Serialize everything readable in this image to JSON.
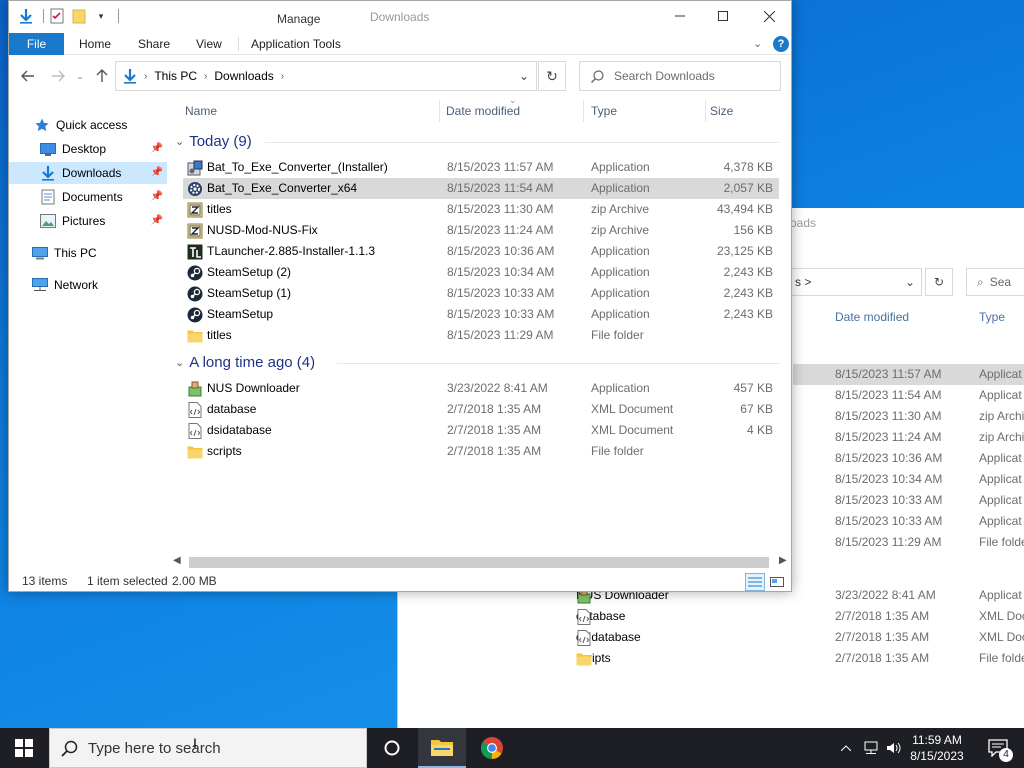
{
  "background_window": {
    "title": "oads",
    "address_crumb": "s",
    "search_text": "Sea",
    "headers": {
      "date": "Date modified",
      "type": "Type"
    },
    "rows": [
      {
        "date": "8/15/2023 11:57 AM",
        "type": "Applicat",
        "selected": true
      },
      {
        "date": "8/15/2023 11:54 AM",
        "type": "Applicat"
      },
      {
        "date": "8/15/2023 11:30 AM",
        "type": "zip Archi"
      },
      {
        "date": "8/15/2023 11:24 AM",
        "type": "zip Archi"
      },
      {
        "date": "8/15/2023 10:36 AM",
        "type": "Applicat"
      },
      {
        "date": "8/15/2023 10:34 AM",
        "type": "Applicat"
      },
      {
        "date": "8/15/2023 10:33 AM",
        "type": "Applicat"
      },
      {
        "date": "8/15/2023 10:33 AM",
        "type": "Applicat"
      },
      {
        "date": "8/15/2023 11:29 AM",
        "type": "File folde"
      }
    ],
    "old_rows": [
      {
        "name": "NUS Downloader",
        "date": "3/23/2022 8:41 AM",
        "type": "Applicat"
      },
      {
        "name": "database",
        "date": "2/7/2018 1:35 AM",
        "type": "XML Doc"
      },
      {
        "name": "dsidatabase",
        "date": "2/7/2018 1:35 AM",
        "type": "XML Doc"
      },
      {
        "name": "scripts",
        "date": "2/7/2018 1:35 AM",
        "type": "File folde"
      }
    ]
  },
  "window": {
    "title": "Downloads",
    "manage_label": "Manage",
    "tabs": {
      "file": "File",
      "home": "Home",
      "share": "Share",
      "view": "View",
      "app_tools": "Application Tools"
    },
    "help": "?",
    "address": {
      "crumb1": "This PC",
      "crumb2": "Downloads"
    },
    "search_placeholder": "Search Downloads",
    "nav": {
      "quick_access": "Quick access",
      "desktop": "Desktop",
      "downloads": "Downloads",
      "documents": "Documents",
      "pictures": "Pictures",
      "this_pc": "This PC",
      "network": "Network"
    },
    "columns": {
      "name": "Name",
      "date": "Date modified",
      "type": "Type",
      "size": "Size"
    },
    "groups": {
      "today": "Today (9)",
      "old": "A long time ago (4)"
    },
    "today_files": [
      {
        "name": "Bat_To_Exe_Converter_(Installer)",
        "date": "8/15/2023 11:57 AM",
        "type": "Application",
        "size": "4,378 KB",
        "icon": "installer-icon"
      },
      {
        "name": "Bat_To_Exe_Converter_x64",
        "date": "8/15/2023 11:54 AM",
        "type": "Application",
        "size": "2,057 KB",
        "icon": "gear-app-icon",
        "selected": true
      },
      {
        "name": "titles",
        "date": "8/15/2023 11:30 AM",
        "type": "zip Archive",
        "size": "43,494 KB",
        "icon": "zip-icon"
      },
      {
        "name": "NUSD-Mod-NUS-Fix",
        "date": "8/15/2023 11:24 AM",
        "type": "zip Archive",
        "size": "156 KB",
        "icon": "zip-icon"
      },
      {
        "name": "TLauncher-2.885-Installer-1.1.3",
        "date": "8/15/2023 10:36 AM",
        "type": "Application",
        "size": "23,125 KB",
        "icon": "tlauncher-icon"
      },
      {
        "name": "SteamSetup (2)",
        "date": "8/15/2023 10:34 AM",
        "type": "Application",
        "size": "2,243 KB",
        "icon": "steam-icon"
      },
      {
        "name": "SteamSetup (1)",
        "date": "8/15/2023 10:33 AM",
        "type": "Application",
        "size": "2,243 KB",
        "icon": "steam-icon"
      },
      {
        "name": "SteamSetup",
        "date": "8/15/2023 10:33 AM",
        "type": "Application",
        "size": "2,243 KB",
        "icon": "steam-icon"
      },
      {
        "name": "titles",
        "date": "8/15/2023 11:29 AM",
        "type": "File folder",
        "size": "",
        "icon": "folder-icon"
      }
    ],
    "old_files": [
      {
        "name": "NUS Downloader",
        "date": "3/23/2022 8:41 AM",
        "type": "Application",
        "size": "457 KB",
        "icon": "nus-app-icon"
      },
      {
        "name": "database",
        "date": "2/7/2018 1:35 AM",
        "type": "XML Document",
        "size": "67 KB",
        "icon": "xml-doc-icon"
      },
      {
        "name": "dsidatabase",
        "date": "2/7/2018 1:35 AM",
        "type": "XML Document",
        "size": "4 KB",
        "icon": "xml-doc-icon"
      },
      {
        "name": "scripts",
        "date": "2/7/2018 1:35 AM",
        "type": "File folder",
        "size": "",
        "icon": "folder-icon"
      }
    ],
    "status": {
      "items": "13 items",
      "selected": "1 item selected",
      "size": "2.00 MB"
    }
  },
  "taskbar": {
    "search_placeholder": "Type here to search",
    "time": "11:59 AM",
    "date": "8/15/2023",
    "notification_count": "4"
  },
  "colors": {
    "accent": "#1979ca",
    "selection": "#d9d9d9",
    "nav_selection": "#cce8ff",
    "taskbar": "#1d1f24"
  }
}
